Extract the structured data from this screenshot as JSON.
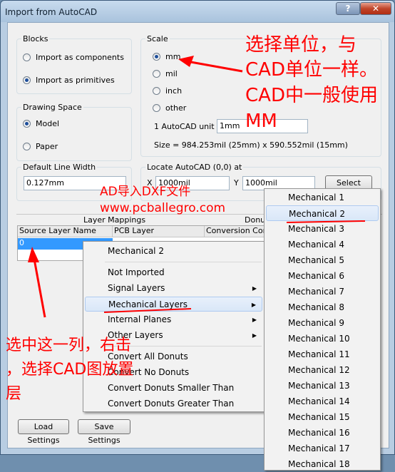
{
  "window": {
    "title": "Import from AutoCAD",
    "help_glyph": "?",
    "close_glyph": "✕"
  },
  "blocks": {
    "label": "Blocks",
    "opt1": "Import as components",
    "opt2": "Import as primitives"
  },
  "space": {
    "label": "Drawing Space",
    "opt1": "Model",
    "opt2": "Paper"
  },
  "scale": {
    "label": "Scale",
    "mm": "mm",
    "mil": "mil",
    "inch": "inch",
    "other": "other",
    "unit_label": "1 AutoCAD unit =",
    "unit_value": "1mm",
    "size_text": "Size = 984.253mil (25mm) x 590.552mil (15mm)"
  },
  "line_width": {
    "label": "Default Line Width",
    "value": "0.127mm"
  },
  "locate": {
    "label": "Locate AutoCAD (0,0) at",
    "x_label": "X",
    "x_value": "1000mil",
    "y_label": "Y",
    "y_value": "1000mil",
    "select": "Select"
  },
  "mappings": {
    "group_label": "Layer Mappings",
    "donuts_label": "Donu",
    "col1": "Source Layer Name",
    "col2": "PCB Layer",
    "col3": "Conversion Cond",
    "row_source": "0"
  },
  "context_menu": {
    "items": [
      "Mechanical 2",
      "Not Imported",
      "Signal Layers",
      "Mechanical Layers",
      "Internal Planes",
      "Other Layers",
      "Convert All Donuts",
      "Convert No Donuts",
      "Convert Donuts Smaller Than",
      "Convert Donuts Greater Than"
    ]
  },
  "submenu": {
    "items": [
      "Mechanical 1",
      "Mechanical 2",
      "Mechanical 3",
      "Mechanical 4",
      "Mechanical 5",
      "Mechanical 6",
      "Mechanical 7",
      "Mechanical 8",
      "Mechanical 9",
      "Mechanical 10",
      "Mechanical 11",
      "Mechanical 12",
      "Mechanical 13",
      "Mechanical 14",
      "Mechanical 15",
      "Mechanical 16",
      "Mechanical 17",
      "Mechanical 18"
    ]
  },
  "buttons": {
    "load": "Load Settings",
    "save": "Save Settings"
  },
  "annotations": {
    "note1_l1": "选择单位，与",
    "note1_l2": "CAD单位一样。",
    "note1_l3": "CAD中一般使用",
    "note1_l4": "MM",
    "center1": "AD导入DXF文件",
    "center2": "www.pcballegro.com",
    "note2_l1": "选中这一列，右击",
    "note2_l2": "，选择CAD图放置",
    "note2_l3": "层"
  },
  "colors": {
    "annotation": "#ff0000",
    "highlight": "#d9e7f8",
    "selection": "#3399ff"
  }
}
